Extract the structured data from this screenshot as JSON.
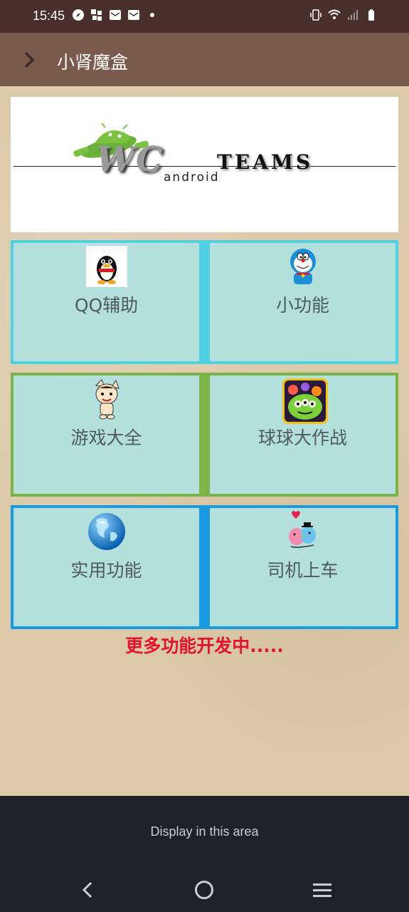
{
  "status": {
    "time": "15:45",
    "left_icons": [
      "compass-icon",
      "app-icon",
      "mail-icon",
      "mail-icon",
      "dot-icon"
    ],
    "right_icons": [
      "vibrate-icon",
      "wifi-icon",
      "signal-icon",
      "battery-icon"
    ]
  },
  "toolbar": {
    "title": "小肾魔盒"
  },
  "banner": {
    "wc": "WC",
    "teams": "TEAMS",
    "android": "android"
  },
  "tiles": [
    {
      "label": "QQ辅助",
      "icon": "qq-penguin-icon",
      "row_color": "#4fd0e4"
    },
    {
      "label": "小功能",
      "icon": "doraemon-icon",
      "row_color": "#4fd0e4"
    },
    {
      "label": "游戏大全",
      "icon": "cartoon-character-icon",
      "row_color": "#7bb34a"
    },
    {
      "label": "球球大作战",
      "icon": "balls-game-icon",
      "row_color": "#7bb34a"
    },
    {
      "label": "实用功能",
      "icon": "globe-icon",
      "row_color": "#1a9be0"
    },
    {
      "label": "司机上车",
      "icon": "birds-love-icon",
      "row_color": "#1a9be0"
    }
  ],
  "footer_note": "更多功能开发中.....",
  "ad": {
    "text": "Display in this area"
  },
  "colors": {
    "status_bar": "#4a302a",
    "toolbar": "#7b5a4e",
    "tile_bg": "#b3dfdd",
    "note_red": "#e2132a"
  }
}
